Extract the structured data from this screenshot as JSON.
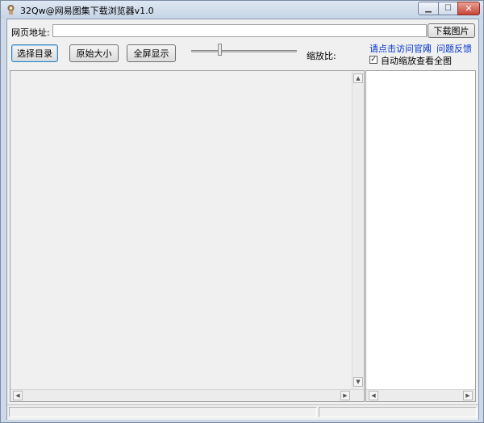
{
  "window": {
    "title": "32Qw@网易图集下载浏览器v1.0"
  },
  "toolbar": {
    "url_label": "网页地址:",
    "url_value": "",
    "download_button": "下载图片",
    "choose_dir_button": "选择目录",
    "original_size_button": "原始大小",
    "fullscreen_button": "全屏显示",
    "zoom_label": "缩放比:",
    "zoom_level": 0.25,
    "visit_site_link": "请点击访问官网",
    "separator": "|",
    "feedback_link": "问题反馈",
    "auto_zoom_label": "自动缩放查看全图",
    "auto_zoom_checked": true
  },
  "icons": {
    "app": "app-icon",
    "minimize": "minimize-icon",
    "maximize": "maximize-icon",
    "close": "close-icon"
  },
  "colors": {
    "link": "#0033cc",
    "close_button": "#c9443a"
  }
}
